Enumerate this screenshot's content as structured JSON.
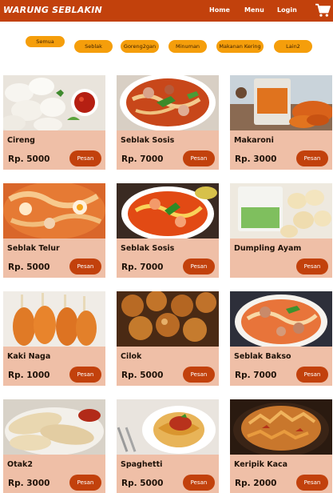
{
  "header": {
    "brand": "WARUNG SEBLAKIN",
    "nav": [
      {
        "label": "Home"
      },
      {
        "label": "Menu"
      },
      {
        "label": "Login"
      }
    ],
    "cart_icon": "shopping-cart-icon"
  },
  "filters": [
    {
      "label": "Semua",
      "active": true
    },
    {
      "label": "Seblak"
    },
    {
      "label": "Goreng2gan"
    },
    {
      "label": "Minuman"
    },
    {
      "label": "Makanan Kering"
    },
    {
      "label": "Lain2"
    }
  ],
  "products": [
    {
      "name": "Cireng",
      "price": "Rp. 5000",
      "button": "Pesan"
    },
    {
      "name": "Seblak Sosis",
      "price": "Rp. 7000",
      "button": "Pesan"
    },
    {
      "name": "Makaroni",
      "price": "Rp. 3000",
      "button": "Pesan"
    },
    {
      "name": "Seblak Telur",
      "price": "Rp. 5000",
      "button": "Pesan"
    },
    {
      "name": "Seblak Sosis",
      "price": "Rp. 7000",
      "button": "Pesan"
    },
    {
      "name": "Dumpling Ayam",
      "price": "",
      "button": "Pesan"
    },
    {
      "name": "Kaki Naga",
      "price": "Rp. 1000",
      "button": "Pesan"
    },
    {
      "name": "Cilok",
      "price": "Rp. 5000",
      "button": "Pesan"
    },
    {
      "name": "Seblak Bakso",
      "price": "Rp. 7000",
      "button": "Pesan"
    },
    {
      "name": "Otak2",
      "price": "Rp. 3000",
      "button": "Pesan"
    },
    {
      "name": "Spaghetti",
      "price": "Rp. 5000",
      "button": "Pesan"
    },
    {
      "name": "Keripik Kaca",
      "price": "Rp. 2000",
      "button": "Pesan"
    }
  ],
  "colors": {
    "accent": "#c2410c",
    "filter": "#f59e0b",
    "card": "#efbfa7"
  }
}
